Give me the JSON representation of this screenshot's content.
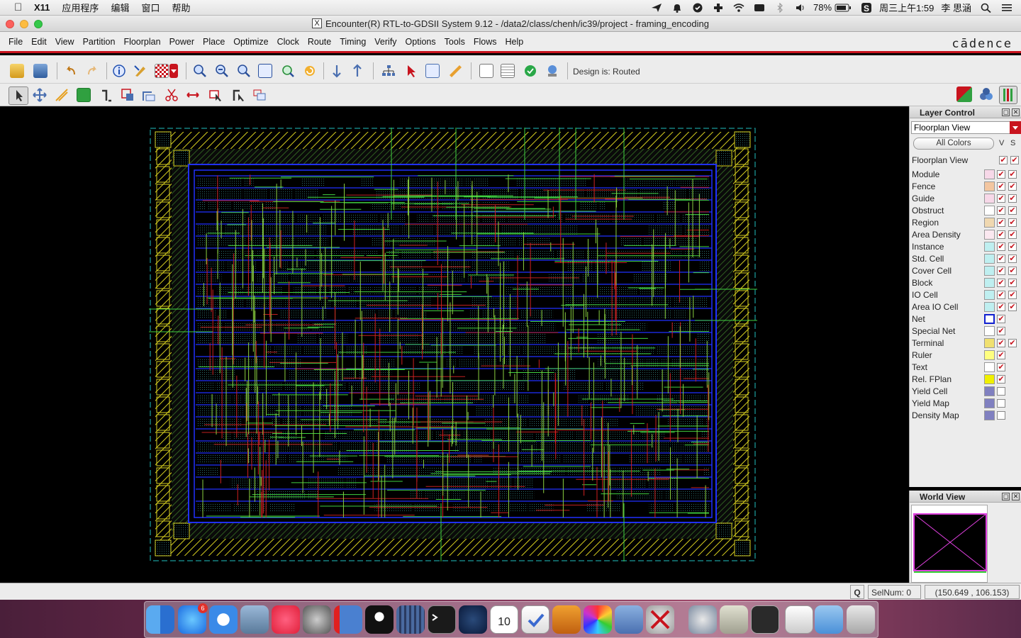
{
  "menubar": {
    "app": "X11",
    "items": [
      "应用程序",
      "编辑",
      "窗口",
      "帮助"
    ],
    "battery": "78%",
    "datetime": "周三上午1:59",
    "user": "李 思涵"
  },
  "window": {
    "title": "Encounter(R) RTL-to-GDSII System 9.12 - /data2/class/chenh/ic39/project - framing_encoding"
  },
  "appmenu": {
    "items": [
      "File",
      "Edit",
      "View",
      "Partition",
      "Floorplan",
      "Power",
      "Place",
      "Optimize",
      "Clock",
      "Route",
      "Timing",
      "Verify",
      "Options",
      "Tools",
      "Flows",
      "Help"
    ],
    "brand": "cādence"
  },
  "toolbar": {
    "design_status": "Design is: Routed"
  },
  "layer_control": {
    "title": "Layer Control",
    "view_select": "Floorplan View",
    "all_colors_button": "All Colors",
    "col_v": "V",
    "col_s": "S",
    "group": "Floorplan View",
    "layers": [
      {
        "name": "Module",
        "color": "#f7d8e8",
        "v": true,
        "s": true
      },
      {
        "name": "Fence",
        "color": "#f3c6a0",
        "v": true,
        "s": true
      },
      {
        "name": "Guide",
        "color": "#f7d8e8",
        "v": true,
        "s": true
      },
      {
        "name": "Obstruct",
        "color": "#ffffff",
        "v": true,
        "s": true
      },
      {
        "name": "Region",
        "color": "#f0d8b0",
        "v": true,
        "s": true
      },
      {
        "name": "Area Density",
        "color": "#fbe8f0",
        "v": true,
        "s": true
      },
      {
        "name": "Instance",
        "color": "#bfeff0",
        "v": true,
        "s": true
      },
      {
        "name": "Std. Cell",
        "color": "#bfeff0",
        "v": true,
        "s": true
      },
      {
        "name": "Cover Cell",
        "color": "#bfeff0",
        "v": true,
        "s": true
      },
      {
        "name": "Block",
        "color": "#bfeff0",
        "v": true,
        "s": true
      },
      {
        "name": "IO Cell",
        "color": "#bfeff0",
        "v": true,
        "s": true
      },
      {
        "name": "Area IO Cell",
        "color": "#bfeff0",
        "v": true,
        "s": true
      },
      {
        "name": "Net",
        "color": "#1020d0",
        "v": true,
        "s": null
      },
      {
        "name": "Special Net",
        "color": "#ffffff",
        "v": true,
        "s": null
      },
      {
        "name": "Terminal",
        "color": "#f0e070",
        "v": true,
        "s": true
      },
      {
        "name": "Ruler",
        "color": "#ffff80",
        "v": true,
        "s": null
      },
      {
        "name": "Text",
        "color": "#ffffff",
        "v": true,
        "s": null
      },
      {
        "name": "Rel. FPlan",
        "color": "#f0f000",
        "v": true,
        "s": null
      },
      {
        "name": "Yield Cell",
        "color": "#8080c0",
        "v": false,
        "s": null
      },
      {
        "name": "Yield Map",
        "color": "#8080c0",
        "v": false,
        "s": null
      },
      {
        "name": "Density Map",
        "color": "#8080c0",
        "v": false,
        "s": null
      }
    ]
  },
  "world_view": {
    "title": "World View"
  },
  "status": {
    "q_button": "Q",
    "selnum": "SelNum: 0",
    "coords": "(150.649 , 106.153)"
  },
  "dock": {
    "badge": "6",
    "calendar_day": "10"
  },
  "colors": {
    "accent_red": "#c8141e",
    "io_yellow": "#d8d020",
    "core_blue": "#2030ff",
    "route_green": "#40d040"
  }
}
